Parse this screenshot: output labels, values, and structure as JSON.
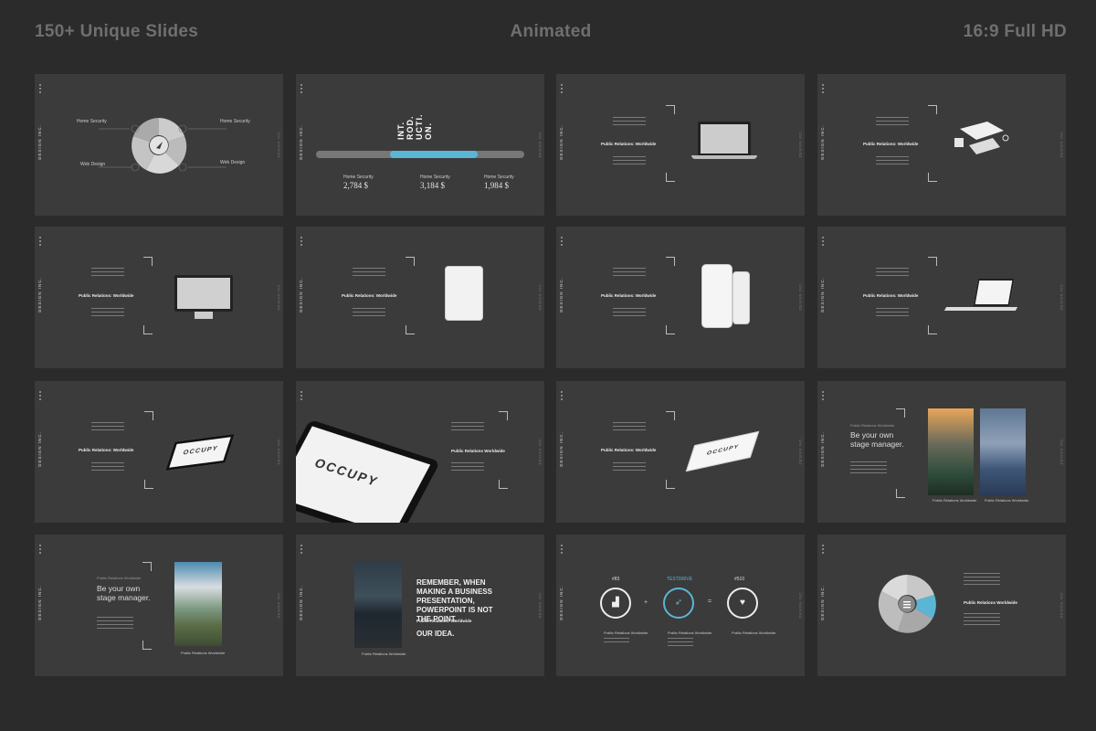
{
  "header": {
    "left": "150+ Unique Slides",
    "center": "Animated",
    "right": "16:9 Full HD"
  },
  "brand": "DESIGN INC.",
  "slide1": {
    "home_security_a": "Home Security",
    "home_security_b": "Home Security",
    "web_design": "Web Design",
    "web_design_b": "Web Design"
  },
  "slide2": {
    "intro": [
      "INT.",
      "ROD.",
      "UCTI.",
      "ON."
    ],
    "stats": [
      {
        "label": "Home Security",
        "value": "2,784 $"
      },
      {
        "label": "Home Security",
        "value": "3,184 $"
      },
      {
        "label": "Home Security",
        "value": "1,984 $"
      }
    ]
  },
  "pr_label": "Public Relations: Worldwide",
  "pr_label_alt": "Public Relations Worldwide",
  "occupy": "OCCUPY",
  "stage": "Be your own stage manager.",
  "remember": {
    "text": "REMEMBER, WHEN MAKING A BUSINESS PRESENTATION, POWERPOINT IS NOT THE POINT.",
    "sub": "Public Relations: Worldwide",
    "idea": "OUR IDEA."
  },
  "slide15": {
    "left_num": "#83",
    "mid_label": "TESTDRIVE",
    "right_num": "#510",
    "plus": "+",
    "equals": "="
  },
  "colors": {
    "background": "#2b2b2b",
    "slide": "#3b3b3b",
    "accent": "#5bb6d6",
    "header": "#6f6f6f"
  }
}
